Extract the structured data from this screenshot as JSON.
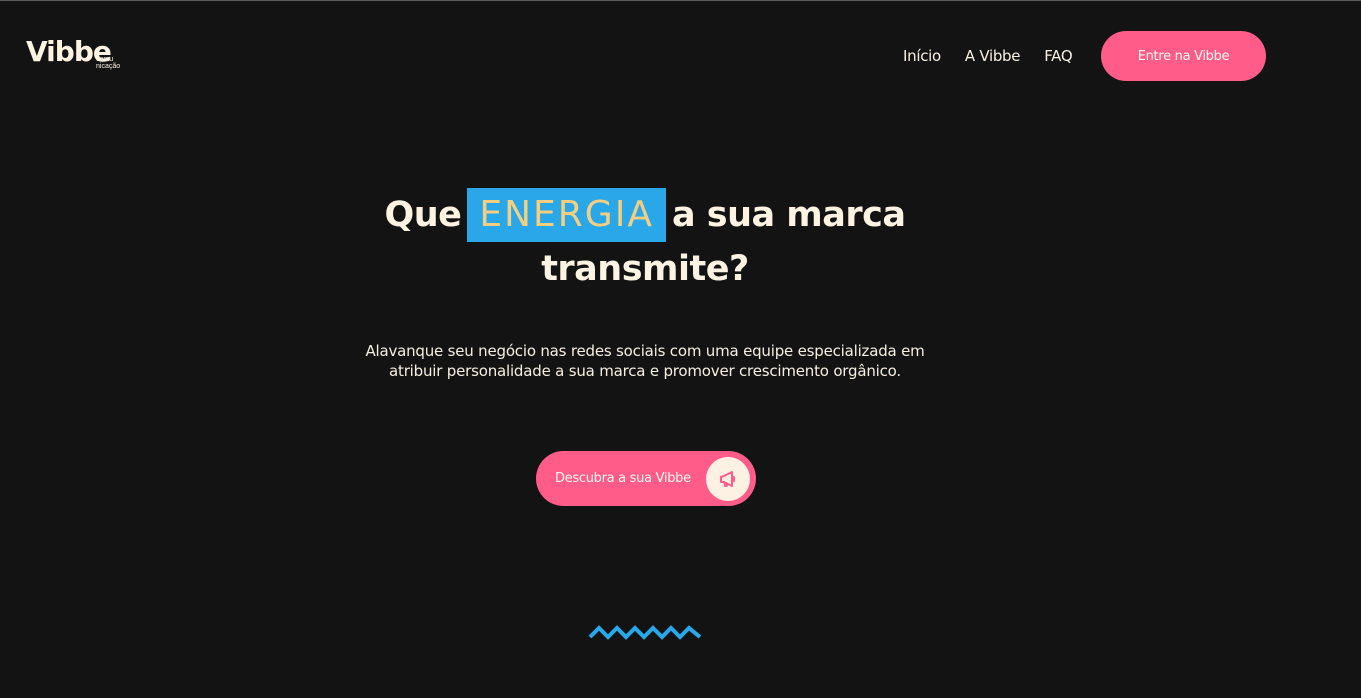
{
  "brand": {
    "logo_word": "Vibbe",
    "logo_sub_1": "comu",
    "logo_sub_2": "nicação"
  },
  "nav": {
    "items": [
      {
        "label": "Início"
      },
      {
        "label": "A Vibbe"
      },
      {
        "label": "FAQ"
      }
    ],
    "cta_label": "Entre na Vibbe"
  },
  "hero": {
    "headline_before": "Que",
    "headline_highlight": "ENERGIA",
    "headline_after": "a sua marca",
    "headline_line2": "transmite?",
    "subtitle_line1": "Alavanque seu negócio nas redes sociais com uma equipe especializada em",
    "subtitle_line2": "atribuir personalidade a sua marca e promover crescimento orgânico.",
    "cta_label": "Descubra a sua Vibbe",
    "cta_icon": "megaphone-icon"
  },
  "colors": {
    "background": "#131313",
    "accent_pink": "#ff5c8a",
    "accent_blue": "#2aa7e8",
    "highlight_text": "#f4cf82",
    "text_cream": "#fdf3e3"
  }
}
